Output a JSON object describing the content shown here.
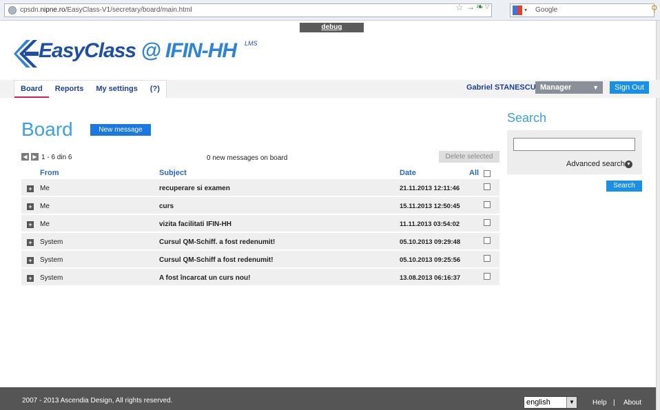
{
  "browser": {
    "url_prefix": "cpsdn.",
    "url_domain": "nipne.ro",
    "url_path": "/EasyClass-V1/secretary/board/main.html",
    "search_engine": "Google"
  },
  "debug_label": "debug",
  "logo": {
    "brand_easy": "EasyClass",
    "brand_rest": " @ IFIN-HH",
    "superscript": "LMS"
  },
  "nav": {
    "tabs": [
      {
        "label": "Board"
      },
      {
        "label": "Reports"
      },
      {
        "label": "My settings"
      },
      {
        "label": "(?)"
      }
    ]
  },
  "user": {
    "name": "Gabriel STANESCU :",
    "role": "Manager",
    "sign_out": "Sign Out"
  },
  "board": {
    "title": "Board",
    "new_message": "New message",
    "pager_range": "1 - 6 din 6",
    "new_count": "0 new messages on board",
    "delete_selected": "Delete selected",
    "columns": {
      "from": "From",
      "subject": "Subject",
      "date": "Date",
      "all": "All"
    },
    "rows": [
      {
        "from": "Me",
        "subject": "recuperare si examen",
        "date": "21.11.2013 12:11:46"
      },
      {
        "from": "Me",
        "subject": "curs",
        "date": "15.11.2013 12:50:45"
      },
      {
        "from": "Me",
        "subject": "vizita facilitati IFIN-HH",
        "date": "11.11.2013 03:54:02"
      },
      {
        "from": "System",
        "subject": "Cursul QM-Schiff. a fost redenumit!",
        "date": "05.10.2013 09:29:48"
      },
      {
        "from": "System",
        "subject": "Cursul QM-Schiff a fost redenumit!",
        "date": "05.10.2013 09:25:56"
      },
      {
        "from": "System",
        "subject": "A fost încarcat un curs nou!",
        "date": "13.08.2013 06:16:37"
      }
    ]
  },
  "search": {
    "title": "Search",
    "input_value": "",
    "advanced": "Advanced search",
    "button": "Search"
  },
  "footer": {
    "copyright": "2007 - 2013 Ascendia Design, All rights reserved.",
    "language": "english",
    "help": "Help",
    "separator": "|",
    "about": "About"
  },
  "colors": {
    "accent": "#3aa0e8",
    "button_blue": "#1a8fe6",
    "nav_text": "#1d3f9c",
    "active_tab": "#e11b52",
    "footer": "#555555"
  }
}
